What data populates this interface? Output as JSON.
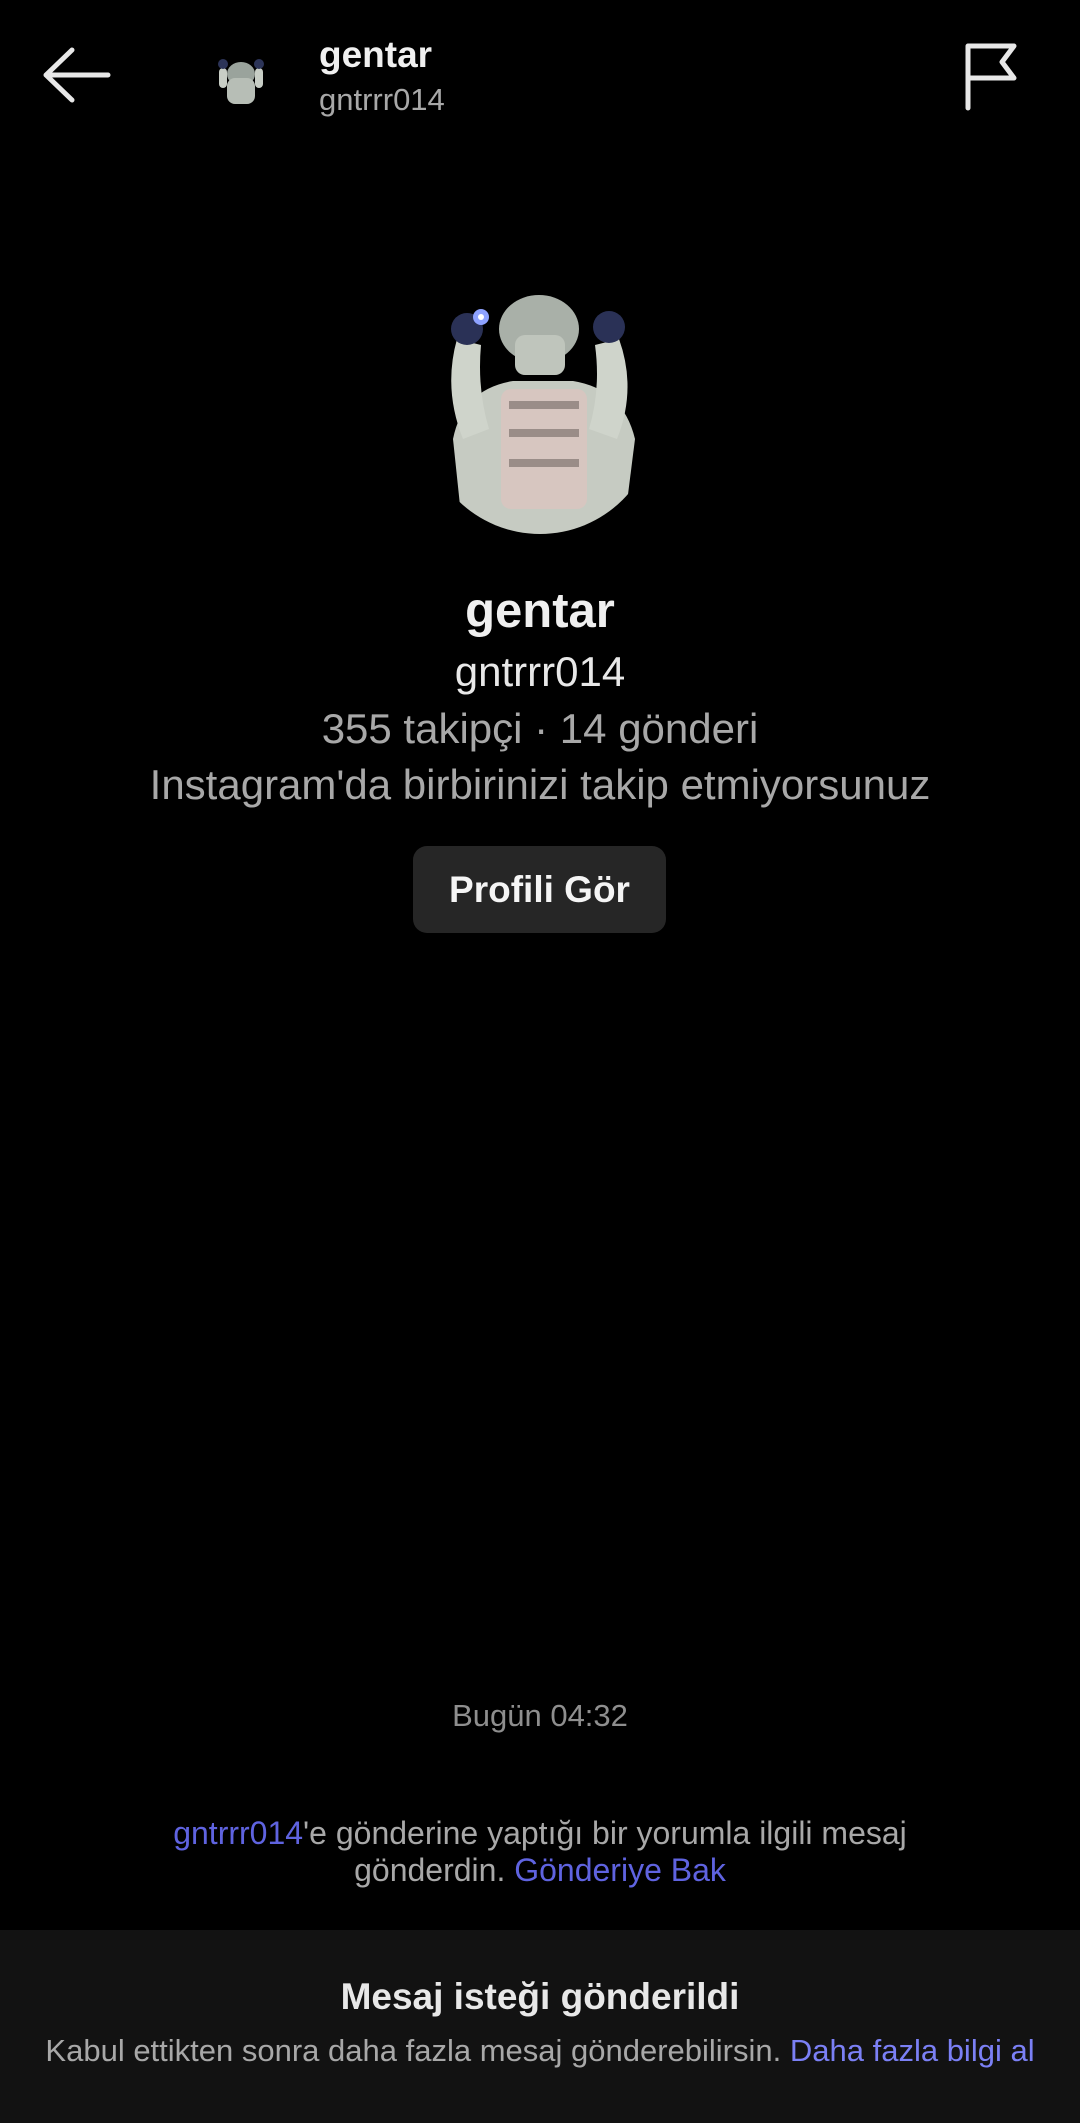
{
  "header": {
    "name": "gentar",
    "handle": "gntrrr014"
  },
  "profile": {
    "name": "gentar",
    "handle": "gntrrr014",
    "stats": "355 takipçi · 14 gönderi",
    "follow_status": "Instagram'da birbirinizi takip etmiyorsunuz",
    "view_profile_label": "Profili Gör"
  },
  "thread": {
    "timestamp": "Bugün 04:32",
    "notice_user": "gntrrr014",
    "notice_line1_suffix": "'e gönderine yaptığı bir yorumla ilgili mesaj",
    "notice_line2": "gönderdin.",
    "notice_link": "Gönderiye Bak"
  },
  "request_banner": {
    "title": "Mesaj isteği gönderildi",
    "text": "Kabul ettikten sonra daha fazla mesaj gönderebilirsin.",
    "link": "Daha fazla bilgi al"
  },
  "icons": {
    "back": "arrow-left-icon",
    "flag": "flag-icon"
  },
  "colors": {
    "background": "#000000",
    "link": "#5f63e0",
    "button_bg": "#262626",
    "banner_bg": "#121212"
  }
}
